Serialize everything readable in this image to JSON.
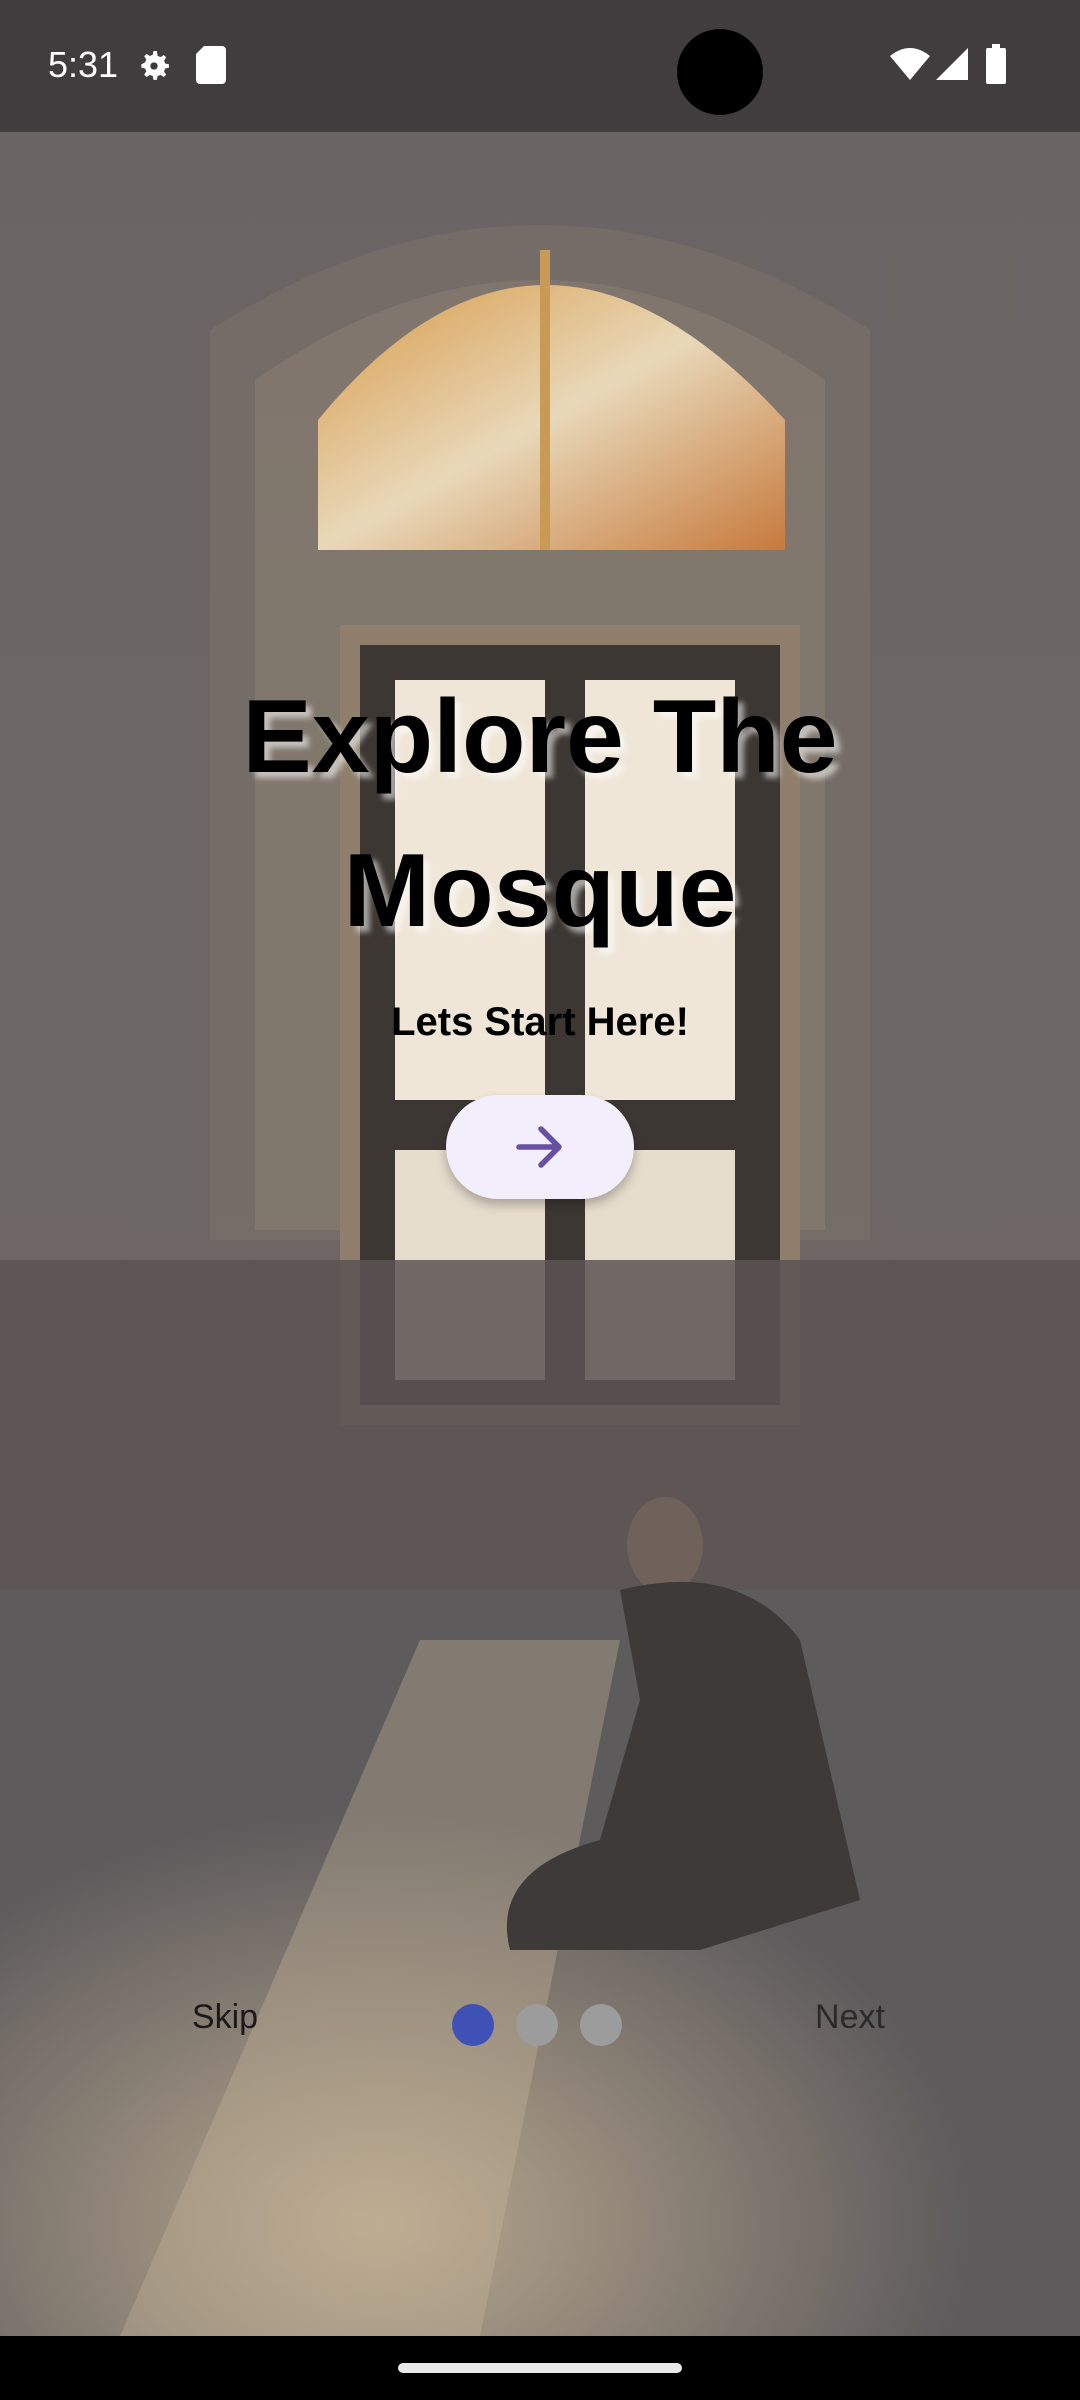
{
  "status_bar": {
    "time": "5:31",
    "icons": [
      "settings-gear-icon",
      "sd-card-icon",
      "wifi-icon",
      "cellular-signal-icon",
      "battery-icon"
    ]
  },
  "onboarding": {
    "title": "Explore The Mosque",
    "subtitle": "Lets Start Here!",
    "start_button_icon": "arrow-right-icon",
    "skip_label": "Skip",
    "next_label": "Next",
    "page_count": 3,
    "current_page": 1
  },
  "colors": {
    "overlay": "#5f5e60",
    "button_bg": "#f3eefb",
    "arrow": "#6750a4",
    "active_dot": "#3f51b5",
    "inactive_dot": "#9c9c9c"
  }
}
